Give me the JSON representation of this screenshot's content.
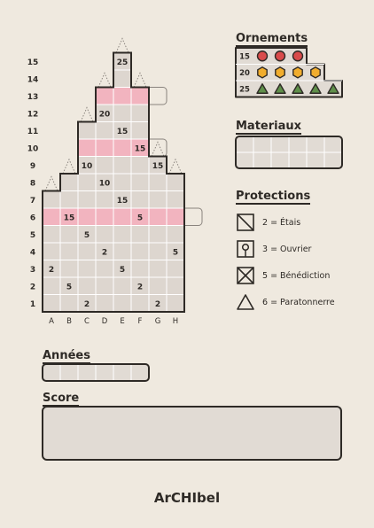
{
  "grid": {
    "columns": [
      "A",
      "B",
      "C",
      "D",
      "E",
      "F",
      "G",
      "H"
    ],
    "rows": [
      "1",
      "2",
      "3",
      "4",
      "5",
      "6",
      "7",
      "8",
      "9",
      "10",
      "11",
      "12",
      "13",
      "14",
      "15"
    ],
    "column_heights": [
      7,
      8,
      11,
      13,
      15,
      13,
      9,
      8
    ],
    "highlight_rows": [
      6,
      10,
      13
    ],
    "numbers": [
      {
        "row": 15,
        "col": 5,
        "value": "25"
      },
      {
        "row": 12,
        "col": 4,
        "value": "20"
      },
      {
        "row": 11,
        "col": 5,
        "value": "15"
      },
      {
        "row": 10,
        "col": 6,
        "value": "15"
      },
      {
        "row": 9,
        "col": 3,
        "value": "10"
      },
      {
        "row": 9,
        "col": 7,
        "value": "15"
      },
      {
        "row": 8,
        "col": 4,
        "value": "10"
      },
      {
        "row": 7,
        "col": 5,
        "value": "15"
      },
      {
        "row": 6,
        "col": 2,
        "value": "15"
      },
      {
        "row": 6,
        "col": 6,
        "value": "5"
      },
      {
        "row": 5,
        "col": 3,
        "value": "5"
      },
      {
        "row": 4,
        "col": 4,
        "value": "2"
      },
      {
        "row": 4,
        "col": 8,
        "value": "5"
      },
      {
        "row": 3,
        "col": 1,
        "value": "2"
      },
      {
        "row": 3,
        "col": 5,
        "value": "5"
      },
      {
        "row": 2,
        "col": 2,
        "value": "5"
      },
      {
        "row": 2,
        "col": 6,
        "value": "2"
      },
      {
        "row": 1,
        "col": 3,
        "value": "2"
      },
      {
        "row": 1,
        "col": 7,
        "value": "2"
      }
    ],
    "colors": {
      "highlight": "#f2b4bf",
      "cell": "#ddd6cf",
      "line": "#ffffff",
      "border": "#2e2a26"
    }
  },
  "ornements": {
    "title": "Ornements",
    "rows": [
      {
        "points": "15",
        "shape": "circle",
        "count": 3,
        "color": "#d94b4b"
      },
      {
        "points": "20",
        "shape": "hexagon",
        "count": 4,
        "color": "#f1ad2d"
      },
      {
        "points": "25",
        "shape": "triangle",
        "count": 5,
        "color": "#5f8f4a"
      }
    ]
  },
  "materiaux": {
    "title": "Materiaux",
    "boxes": 6
  },
  "protections": {
    "title": "Protections",
    "items": [
      {
        "icon": "etais-icon",
        "label": "2 = Étais"
      },
      {
        "icon": "ouvrier-icon",
        "label": "3 = Ouvrier"
      },
      {
        "icon": "benediction-icon",
        "label": "5 = Bénédiction"
      },
      {
        "icon": "paratonnerre-icon",
        "label": "6 = Paratonnerre"
      }
    ]
  },
  "annees": {
    "title": "Années",
    "boxes": 6
  },
  "score": {
    "title": "Score"
  },
  "logo": "ArCHIbel"
}
